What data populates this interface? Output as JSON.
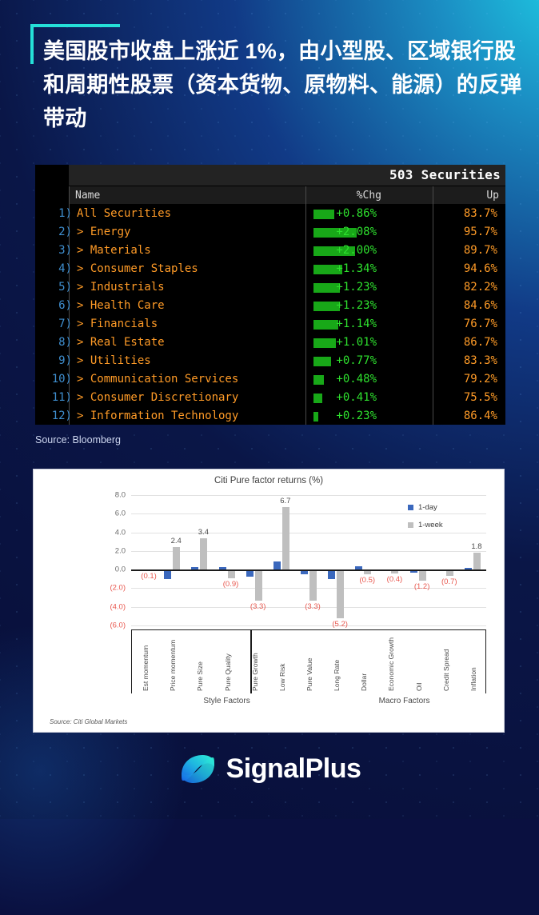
{
  "theme": {
    "bg_dark": "#0a1040",
    "accent_cyan": "#25e0d8",
    "bloomberg_orange": "#ff9b27",
    "bloomberg_green": "#2ee02e",
    "chart_blue": "#3b68bd",
    "chart_gray": "#bfbfbf",
    "negative_red": "#e8574e"
  },
  "header": {
    "title": "美国股市收盘上涨近 1%，由小型股、区域银行股和周期性股票（资本货物、原物料、能源）的反弹带动"
  },
  "bloomberg": {
    "securities_count_label": "503 Securities",
    "columns": {
      "name": "Name",
      "chg": "%Chg",
      "up": "Up"
    },
    "rows": [
      {
        "num": "1)",
        "name": "All Securities",
        "expander": "",
        "chg": "+0.86%",
        "up": "83.7%",
        "bar": 26
      },
      {
        "num": "2)",
        "name": "Energy",
        "expander": ">",
        "chg": "+2.08%",
        "up": "95.7%",
        "bar": 54
      },
      {
        "num": "3)",
        "name": "Materials",
        "expander": ">",
        "chg": "+2.00%",
        "up": "89.7%",
        "bar": 52
      },
      {
        "num": "4)",
        "name": "Consumer Staples",
        "expander": ">",
        "chg": "+1.34%",
        "up": "94.6%",
        "bar": 36
      },
      {
        "num": "5)",
        "name": "Industrials",
        "expander": ">",
        "chg": "+1.23%",
        "up": "82.2%",
        "bar": 33
      },
      {
        "num": "6)",
        "name": "Health Care",
        "expander": ">",
        "chg": "+1.23%",
        "up": "84.6%",
        "bar": 33
      },
      {
        "num": "7)",
        "name": "Financials",
        "expander": ">",
        "chg": "+1.14%",
        "up": "76.7%",
        "bar": 31
      },
      {
        "num": "8)",
        "name": "Real Estate",
        "expander": ">",
        "chg": "+1.01%",
        "up": "86.7%",
        "bar": 28
      },
      {
        "num": "9)",
        "name": "Utilities",
        "expander": ">",
        "chg": "+0.77%",
        "up": "83.3%",
        "bar": 22
      },
      {
        "num": "10)",
        "name": "Communication Services",
        "expander": ">",
        "chg": "+0.48%",
        "up": "79.2%",
        "bar": 13
      },
      {
        "num": "11)",
        "name": "Consumer Discretionary",
        "expander": ">",
        "chg": "+0.41%",
        "up": "75.5%",
        "bar": 11
      },
      {
        "num": "12)",
        "name": "Information Technology",
        "expander": ">",
        "chg": "+0.23%",
        "up": "86.4%",
        "bar": 6
      }
    ],
    "source": "Source: Bloomberg"
  },
  "chart_data": {
    "type": "bar",
    "title": "Citi Pure factor returns (%)",
    "xlabel": "",
    "ylabel": "",
    "ylim": [
      -6.0,
      8.0
    ],
    "yticks": [
      "8.0",
      "6.0",
      "4.0",
      "2.0",
      "0.0",
      "(2.0)",
      "(4.0)",
      "(6.0)"
    ],
    "ytick_values": [
      8.0,
      6.0,
      4.0,
      2.0,
      0.0,
      -2.0,
      -4.0,
      -6.0
    ],
    "grid": true,
    "legend_position": "top-right",
    "categories": [
      "Est momentum",
      "Price momentum",
      "Pure Size",
      "Pure Quality",
      "Pure Growth",
      "Low Risk",
      "Pure Value",
      "Long Rate",
      "Dollar",
      "Economic Growth",
      "Oil",
      "Credit Spread",
      "Inflation"
    ],
    "groups": [
      {
        "label": "Style Factors",
        "start": 0,
        "end": 6
      },
      {
        "label": "Macro Factors",
        "start": 7,
        "end": 12
      }
    ],
    "series": [
      {
        "name": "1-day",
        "color": "#3b68bd",
        "values": [
          -0.05,
          -1.0,
          0.25,
          0.3,
          -0.75,
          0.9,
          -0.5,
          -1.0,
          0.35,
          -0.2,
          -0.3,
          -0.05,
          0.2
        ]
      },
      {
        "name": "1-week",
        "color": "#bfbfbf",
        "values": [
          -0.1,
          2.4,
          3.4,
          -0.9,
          -3.3,
          6.7,
          -3.3,
          -5.2,
          -0.5,
          -0.4,
          -1.2,
          -0.7,
          1.8
        ]
      }
    ],
    "data_labels": [
      {
        "index": 0,
        "text": "(0.1)",
        "sign": "neg"
      },
      {
        "index": 1,
        "text": "2.4",
        "sign": "pos"
      },
      {
        "index": 2,
        "text": "3.4",
        "sign": "pos"
      },
      {
        "index": 3,
        "text": "(0.9)",
        "sign": "neg"
      },
      {
        "index": 4,
        "text": "(3.3)",
        "sign": "neg"
      },
      {
        "index": 5,
        "text": "6.7",
        "sign": "pos"
      },
      {
        "index": 6,
        "text": "(3.3)",
        "sign": "neg"
      },
      {
        "index": 7,
        "text": "(5.2)",
        "sign": "neg"
      },
      {
        "index": 8,
        "text": "(0.5)",
        "sign": "neg"
      },
      {
        "index": 9,
        "text": "(0.4)",
        "sign": "neg"
      },
      {
        "index": 10,
        "text": "(1.2)",
        "sign": "neg"
      },
      {
        "index": 11,
        "text": "(0.7)",
        "sign": "neg"
      },
      {
        "index": 12,
        "text": "1.8",
        "sign": "pos"
      }
    ],
    "source": "Source: Citi Global Markets"
  },
  "footer": {
    "brand": "SignalPlus"
  }
}
